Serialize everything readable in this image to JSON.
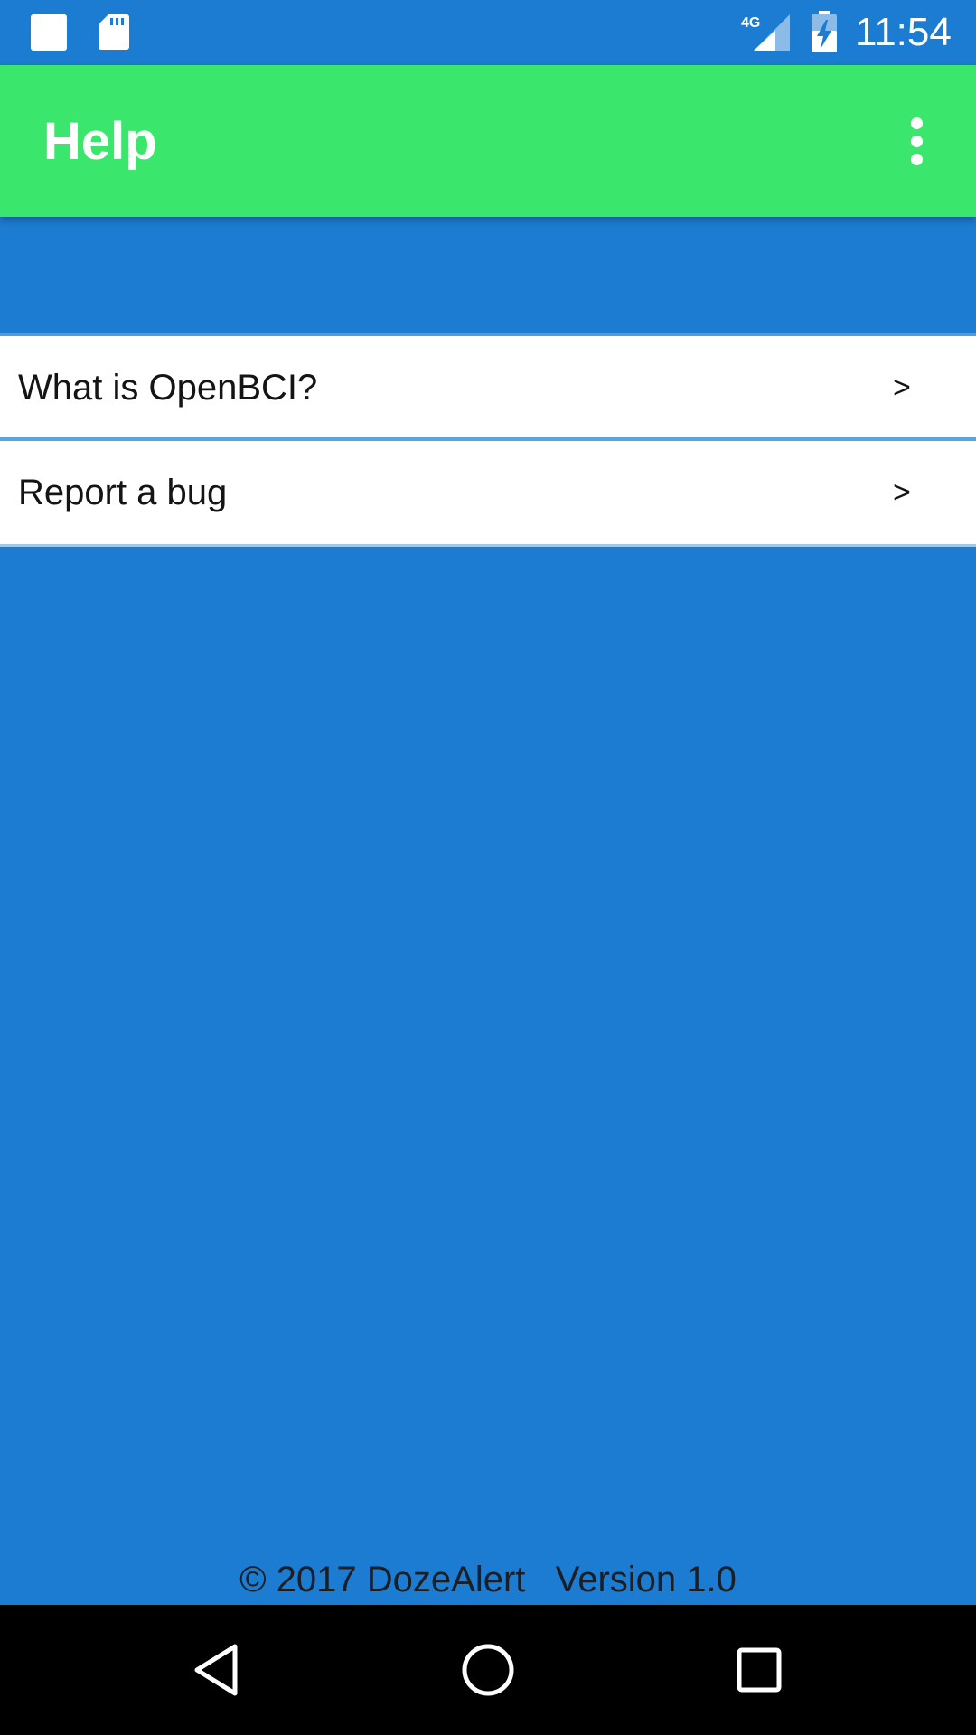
{
  "status_bar": {
    "time": "11:54",
    "network": "4G",
    "icons": [
      "notification-square-icon",
      "sd-card-icon",
      "signal-4g-icon",
      "battery-charging-icon"
    ]
  },
  "app_bar": {
    "title": "Help",
    "menu_icon": "overflow-menu-icon",
    "color": "#3be66c"
  },
  "list": {
    "items": [
      {
        "label": "What is OpenBCI?",
        "chevron": ">"
      },
      {
        "label": "Report a bug",
        "chevron": ">"
      }
    ]
  },
  "footer": {
    "copyright": "© 2017 DozeAlert",
    "version": "Version 1.0"
  },
  "nav_bar": {
    "icons": [
      "back-icon",
      "home-icon",
      "recents-icon"
    ]
  },
  "colors": {
    "background": "#1c7cd1",
    "app_bar": "#3be66c",
    "list_background": "#ffffff",
    "nav_bar": "#000000"
  }
}
